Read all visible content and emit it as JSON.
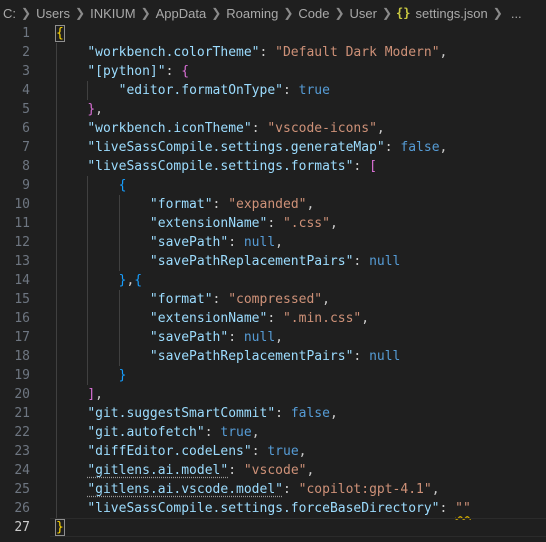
{
  "breadcrumb": {
    "items": [
      "C:",
      "Users",
      "INKIUM",
      "AppData",
      "Roaming",
      "Code",
      "User"
    ],
    "file_icon": "{}",
    "file_name": "settings.json",
    "more": "..."
  },
  "editor": {
    "lines": [
      {
        "n": "1",
        "t": [
          {
            "c": "pm",
            "x": "{"
          }
        ]
      },
      {
        "n": "2",
        "t": [
          {
            "c": "",
            "x": "    "
          },
          {
            "c": "k",
            "x": "\"workbench.colorTheme\""
          },
          {
            "c": "",
            "x": ": "
          },
          {
            "c": "s",
            "x": "\"Default Dark Modern\""
          },
          {
            "c": "",
            "x": ","
          }
        ]
      },
      {
        "n": "3",
        "t": [
          {
            "c": "",
            "x": "    "
          },
          {
            "c": "k",
            "x": "\"[python]\""
          },
          {
            "c": "",
            "x": ": "
          },
          {
            "c": "p2",
            "x": "{"
          }
        ]
      },
      {
        "n": "4",
        "t": [
          {
            "c": "",
            "x": "        "
          },
          {
            "c": "k",
            "x": "\"editor.formatOnType\""
          },
          {
            "c": "",
            "x": ": "
          },
          {
            "c": "b",
            "x": "true"
          }
        ]
      },
      {
        "n": "5",
        "t": [
          {
            "c": "",
            "x": "    "
          },
          {
            "c": "p2",
            "x": "}"
          },
          {
            "c": "",
            "x": ","
          }
        ]
      },
      {
        "n": "6",
        "t": [
          {
            "c": "",
            "x": "    "
          },
          {
            "c": "k",
            "x": "\"workbench.iconTheme\""
          },
          {
            "c": "",
            "x": ": "
          },
          {
            "c": "s",
            "x": "\"vscode-icons\""
          },
          {
            "c": "",
            "x": ","
          }
        ]
      },
      {
        "n": "7",
        "t": [
          {
            "c": "",
            "x": "    "
          },
          {
            "c": "k",
            "x": "\"liveSassCompile.settings.generateMap\""
          },
          {
            "c": "",
            "x": ": "
          },
          {
            "c": "b",
            "x": "false"
          },
          {
            "c": "",
            "x": ","
          }
        ]
      },
      {
        "n": "8",
        "t": [
          {
            "c": "",
            "x": "    "
          },
          {
            "c": "k",
            "x": "\"liveSassCompile.settings.formats\""
          },
          {
            "c": "",
            "x": ": "
          },
          {
            "c": "p2",
            "x": "["
          }
        ]
      },
      {
        "n": "9",
        "t": [
          {
            "c": "",
            "x": "        "
          },
          {
            "c": "p3",
            "x": "{"
          }
        ]
      },
      {
        "n": "10",
        "t": [
          {
            "c": "",
            "x": "            "
          },
          {
            "c": "k",
            "x": "\"format\""
          },
          {
            "c": "",
            "x": ": "
          },
          {
            "c": "s",
            "x": "\"expanded\""
          },
          {
            "c": "",
            "x": ","
          }
        ]
      },
      {
        "n": "11",
        "t": [
          {
            "c": "",
            "x": "            "
          },
          {
            "c": "k",
            "x": "\"extensionName\""
          },
          {
            "c": "",
            "x": ": "
          },
          {
            "c": "s",
            "x": "\".css\""
          },
          {
            "c": "",
            "x": ","
          }
        ]
      },
      {
        "n": "12",
        "t": [
          {
            "c": "",
            "x": "            "
          },
          {
            "c": "k",
            "x": "\"savePath\""
          },
          {
            "c": "",
            "x": ": "
          },
          {
            "c": "b",
            "x": "null"
          },
          {
            "c": "",
            "x": ","
          }
        ]
      },
      {
        "n": "13",
        "t": [
          {
            "c": "",
            "x": "            "
          },
          {
            "c": "k",
            "x": "\"savePathReplacementPairs\""
          },
          {
            "c": "",
            "x": ": "
          },
          {
            "c": "b",
            "x": "null"
          }
        ]
      },
      {
        "n": "14",
        "t": [
          {
            "c": "",
            "x": "        "
          },
          {
            "c": "p3",
            "x": "}"
          },
          {
            "c": "",
            "x": ","
          },
          {
            "c": "p3",
            "x": "{"
          }
        ]
      },
      {
        "n": "15",
        "t": [
          {
            "c": "",
            "x": "            "
          },
          {
            "c": "k",
            "x": "\"format\""
          },
          {
            "c": "",
            "x": ": "
          },
          {
            "c": "s",
            "x": "\"compressed\""
          },
          {
            "c": "",
            "x": ","
          }
        ]
      },
      {
        "n": "16",
        "t": [
          {
            "c": "",
            "x": "            "
          },
          {
            "c": "k",
            "x": "\"extensionName\""
          },
          {
            "c": "",
            "x": ": "
          },
          {
            "c": "s",
            "x": "\".min.css\""
          },
          {
            "c": "",
            "x": ","
          }
        ]
      },
      {
        "n": "17",
        "t": [
          {
            "c": "",
            "x": "            "
          },
          {
            "c": "k",
            "x": "\"savePath\""
          },
          {
            "c": "",
            "x": ": "
          },
          {
            "c": "b",
            "x": "null"
          },
          {
            "c": "",
            "x": ","
          }
        ]
      },
      {
        "n": "18",
        "t": [
          {
            "c": "",
            "x": "            "
          },
          {
            "c": "k",
            "x": "\"savePathReplacementPairs\""
          },
          {
            "c": "",
            "x": ": "
          },
          {
            "c": "b",
            "x": "null"
          }
        ]
      },
      {
        "n": "19",
        "t": [
          {
            "c": "",
            "x": "        "
          },
          {
            "c": "p3",
            "x": "}"
          }
        ]
      },
      {
        "n": "20",
        "t": [
          {
            "c": "",
            "x": "    "
          },
          {
            "c": "p2",
            "x": "]"
          },
          {
            "c": "",
            "x": ","
          }
        ]
      },
      {
        "n": "21",
        "t": [
          {
            "c": "",
            "x": "    "
          },
          {
            "c": "k",
            "x": "\"git.suggestSmartCommit\""
          },
          {
            "c": "",
            "x": ": "
          },
          {
            "c": "b",
            "x": "false"
          },
          {
            "c": "",
            "x": ","
          }
        ]
      },
      {
        "n": "22",
        "t": [
          {
            "c": "",
            "x": "    "
          },
          {
            "c": "k",
            "x": "\"git.autofetch\""
          },
          {
            "c": "",
            "x": ": "
          },
          {
            "c": "b",
            "x": "true"
          },
          {
            "c": "",
            "x": ","
          }
        ]
      },
      {
        "n": "23",
        "t": [
          {
            "c": "",
            "x": "    "
          },
          {
            "c": "k",
            "x": "\"diffEditor.codeLens\""
          },
          {
            "c": "",
            "x": ": "
          },
          {
            "c": "b",
            "x": "true"
          },
          {
            "c": "",
            "x": ","
          }
        ]
      },
      {
        "n": "24",
        "t": [
          {
            "c": "",
            "x": "    "
          },
          {
            "c": "k dots",
            "x": "\"gitlens.ai.model\""
          },
          {
            "c": "",
            "x": ": "
          },
          {
            "c": "s",
            "x": "\"vscode\""
          },
          {
            "c": "",
            "x": ","
          }
        ]
      },
      {
        "n": "25",
        "t": [
          {
            "c": "",
            "x": "    "
          },
          {
            "c": "k dots",
            "x": "\"gitlens.ai.vscode.model\""
          },
          {
            "c": "",
            "x": ": "
          },
          {
            "c": "s",
            "x": "\"copilot:gpt-4.1\""
          },
          {
            "c": "",
            "x": ","
          }
        ]
      },
      {
        "n": "26",
        "t": [
          {
            "c": "",
            "x": "    "
          },
          {
            "c": "k",
            "x": "\"liveSassCompile.settings.forceBaseDirectory\""
          },
          {
            "c": "",
            "x": ": "
          },
          {
            "c": "s squig",
            "x": "\"\""
          }
        ]
      },
      {
        "n": "27",
        "t": [
          {
            "c": "pm",
            "x": "}"
          },
          {
            "c": "cursor",
            "x": ""
          }
        ]
      }
    ],
    "current_line": "27"
  },
  "colors": {
    "background": "#1f1f1f",
    "key": "#9cdcfe",
    "string": "#ce9178",
    "keyword": "#569cd6",
    "bracket_level1": "#ffd700",
    "bracket_level2": "#da70d6",
    "bracket_level3": "#179fff",
    "warning_squiggle": "#cca700"
  }
}
